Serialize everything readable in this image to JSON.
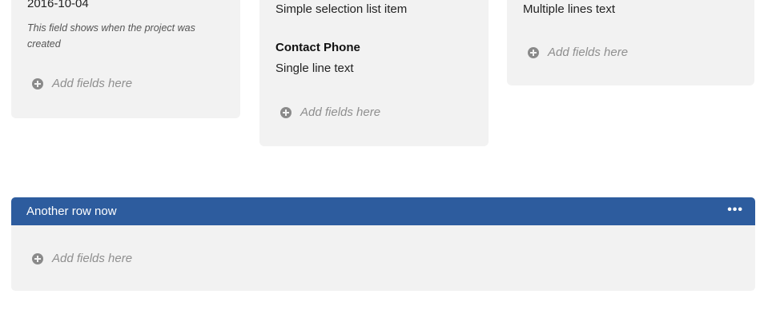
{
  "columns": [
    {
      "value": "2016-10-04",
      "help": "This field shows when the project was created",
      "add_label": "Add fields here"
    },
    {
      "value": "Simple selection list item",
      "label2": "Contact Phone",
      "value2": "Single line text",
      "add_label": "Add fields here"
    },
    {
      "value": "Multiple lines text",
      "add_label": "Add fields here"
    }
  ],
  "row2": {
    "title": "Another row now",
    "menu": "•••",
    "add_label": "Add fields here"
  },
  "colors": {
    "header_blue": "#2d5c9e",
    "card_bg": "#f2f2f2",
    "muted_text": "#8f8f8f"
  }
}
